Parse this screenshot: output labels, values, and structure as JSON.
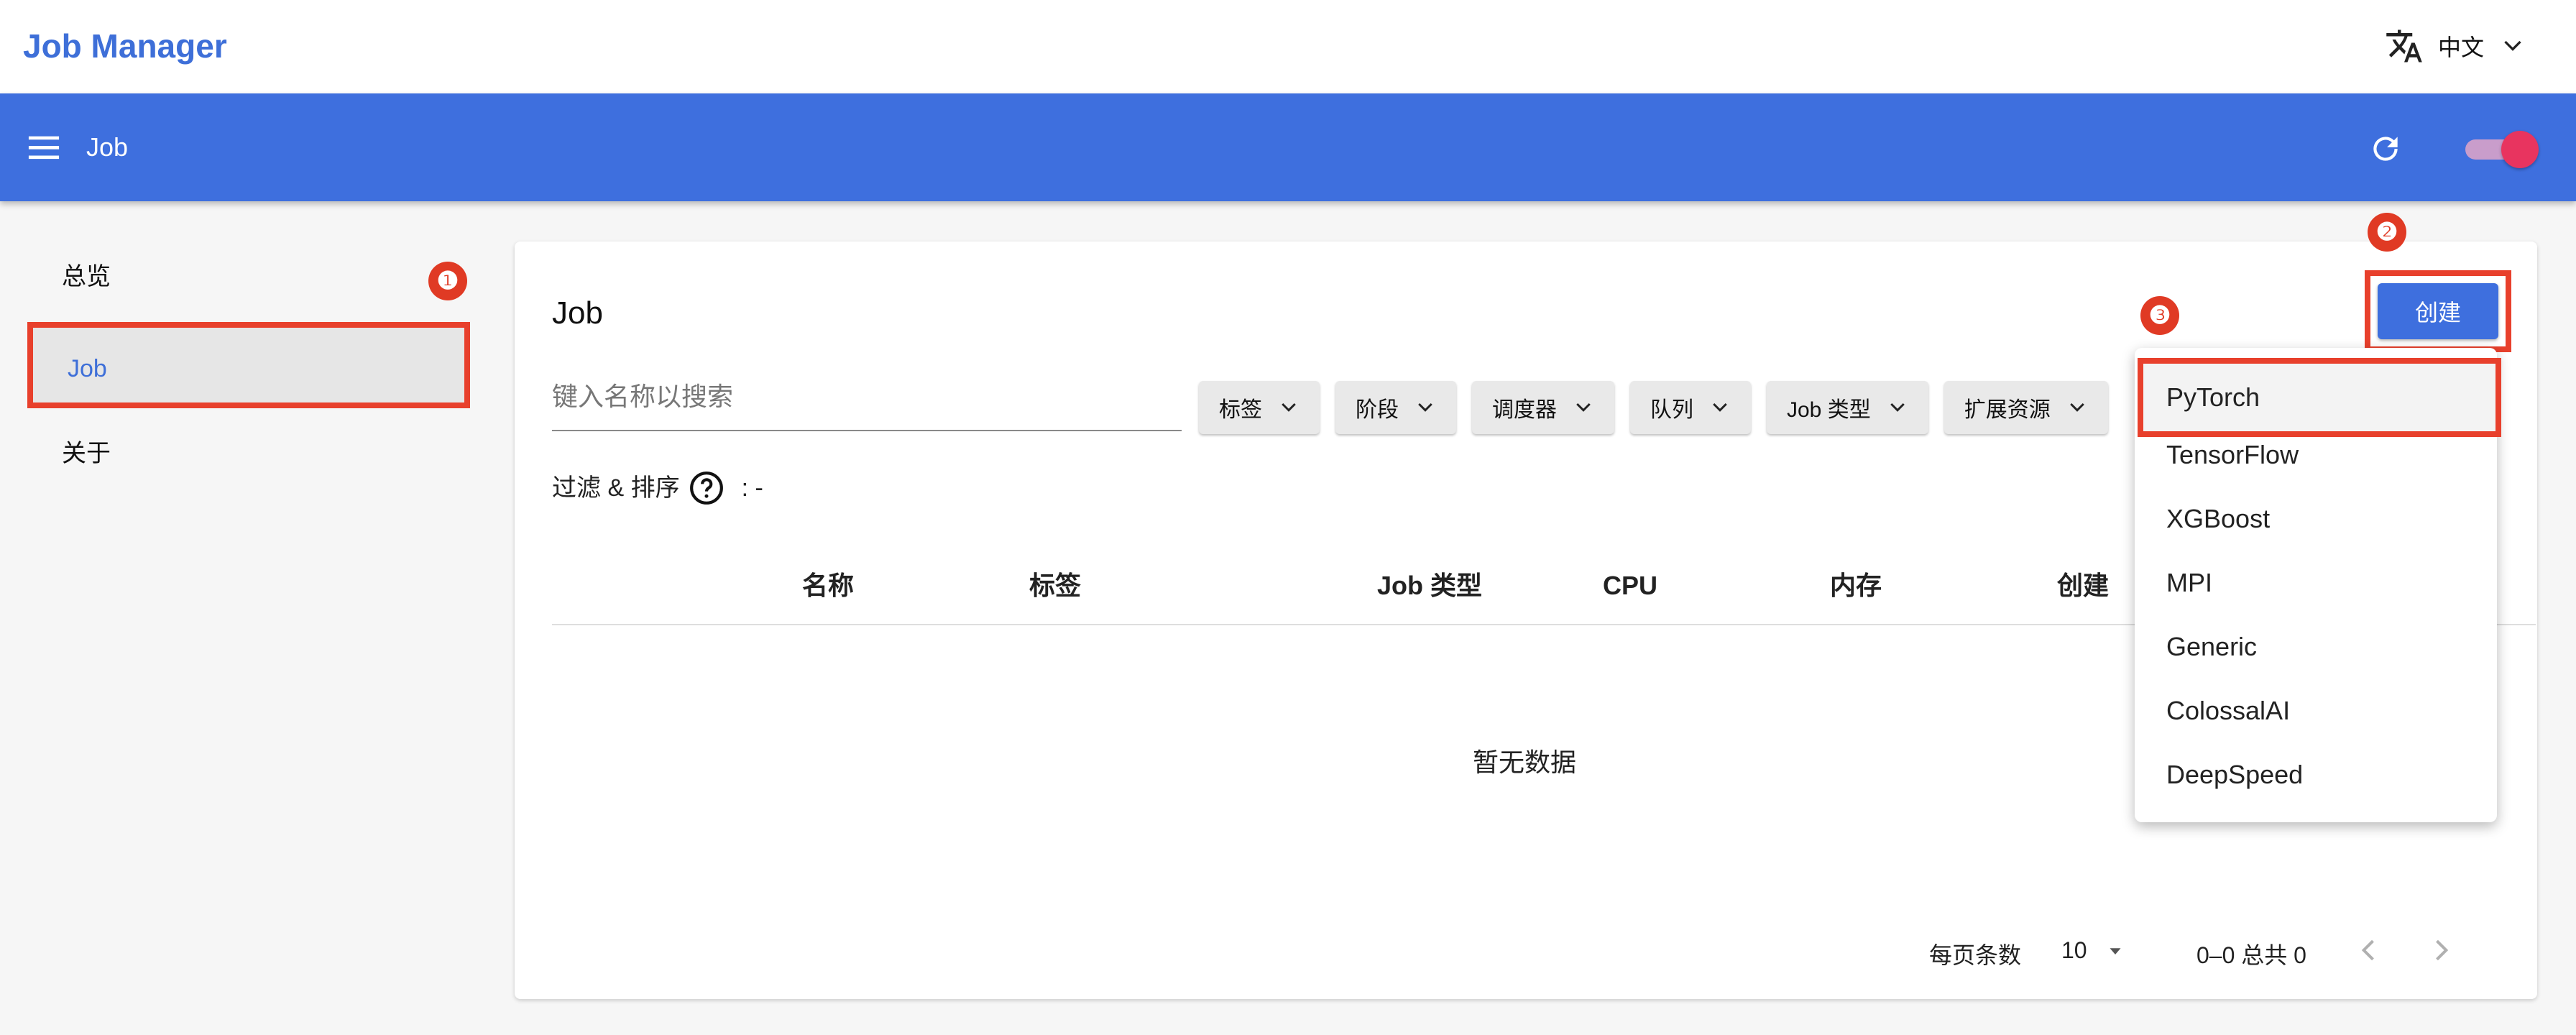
{
  "header": {
    "app_title": "Job Manager",
    "language": "中文"
  },
  "appbar": {
    "title": "Job"
  },
  "sidebar": {
    "items": [
      {
        "label": "总览"
      },
      {
        "label": "Job",
        "active": true
      },
      {
        "label": "关于"
      }
    ]
  },
  "markers": [
    "❶",
    "❷",
    "❸"
  ],
  "main": {
    "title": "Job",
    "search_placeholder": "键入名称以搜索",
    "filters": [
      "标签",
      "阶段",
      "调度器",
      "队列",
      "Job 类型",
      "扩展资源"
    ],
    "filter_sort_label": "过滤 & 排序",
    "filter_sort_value": ":  -",
    "columns": [
      "名称",
      "标签",
      "Job 类型",
      "CPU",
      "内存",
      "创建"
    ],
    "empty_text": "暂无数据",
    "pagination": {
      "rows_per_page_label": "每页条数",
      "rows_per_page_value": "10",
      "range_text": "0–0 总共 0"
    },
    "create_label": "创建"
  },
  "create_menu": {
    "items": [
      "PyTorch",
      "TensorFlow",
      "XGBoost",
      "MPI",
      "Generic",
      "ColossalAI",
      "DeepSpeed"
    ]
  },
  "colors": {
    "brand": "#3e6fde",
    "highlight": "#e8402c",
    "toggle": "#e8345f"
  }
}
